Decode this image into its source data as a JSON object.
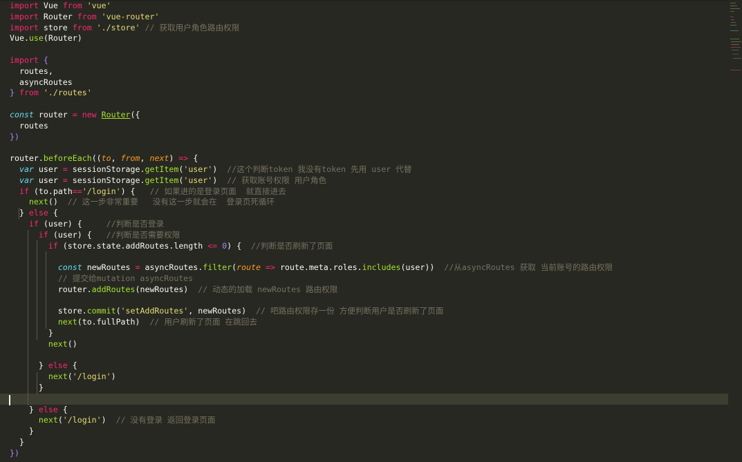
{
  "editor": {
    "lines": [
      [
        [
          "k",
          "import"
        ],
        [
          "t",
          " Vue "
        ],
        [
          "k",
          "from"
        ],
        [
          "t",
          " "
        ],
        [
          "s",
          "'vue'"
        ]
      ],
      [
        [
          "k",
          "import"
        ],
        [
          "t",
          " Router "
        ],
        [
          "k",
          "from"
        ],
        [
          "t",
          " "
        ],
        [
          "s",
          "'vue-router'"
        ]
      ],
      [
        [
          "k",
          "import"
        ],
        [
          "t",
          " store "
        ],
        [
          "k",
          "from"
        ],
        [
          "t",
          " "
        ],
        [
          "s",
          "'./store'"
        ],
        [
          "t",
          " "
        ],
        [
          "c",
          "// 获取用户角色路由权限"
        ]
      ],
      [
        [
          "t",
          "Vue."
        ],
        [
          "f",
          "use"
        ],
        [
          "t",
          "(Router)"
        ]
      ],
      [],
      [
        [
          "k",
          "import"
        ],
        [
          "t",
          " "
        ],
        [
          "n",
          "{"
        ]
      ],
      [
        [
          "t",
          "  routes,"
        ]
      ],
      [
        [
          "t",
          "  asyncRoutes"
        ]
      ],
      [
        [
          "n",
          "}"
        ],
        [
          "t",
          " "
        ],
        [
          "k",
          "from"
        ],
        [
          "t",
          " "
        ],
        [
          "s",
          "'./routes'"
        ]
      ],
      [],
      [
        [
          "b",
          "const"
        ],
        [
          "t",
          " router "
        ],
        [
          "k",
          "="
        ],
        [
          "t",
          " "
        ],
        [
          "k",
          "new"
        ],
        [
          "t",
          " "
        ],
        [
          "cls",
          "Router"
        ],
        [
          "t",
          "({"
        ]
      ],
      [
        [
          "t",
          "  routes"
        ]
      ],
      [
        [
          "n",
          "})"
        ]
      ],
      [],
      [
        [
          "t",
          "router."
        ],
        [
          "f",
          "beforeEach"
        ],
        [
          "t",
          "(("
        ],
        [
          "p",
          "to"
        ],
        [
          "t",
          ", "
        ],
        [
          "p",
          "from"
        ],
        [
          "t",
          ", "
        ],
        [
          "p",
          "next"
        ],
        [
          "t",
          ") "
        ],
        [
          "k",
          "=>"
        ],
        [
          "t",
          " {"
        ]
      ],
      [
        [
          "t",
          "  "
        ],
        [
          "b",
          "var"
        ],
        [
          "t",
          " user "
        ],
        [
          "k",
          "="
        ],
        [
          "t",
          " sessionStorage."
        ],
        [
          "f",
          "getItem"
        ],
        [
          "t",
          "("
        ],
        [
          "s",
          "'user'"
        ],
        [
          "t",
          ")  "
        ],
        [
          "c",
          "//这个判断token 我没有token 先用 user 代替"
        ]
      ],
      [
        [
          "t",
          "  "
        ],
        [
          "b",
          "var"
        ],
        [
          "t",
          " user "
        ],
        [
          "k",
          "="
        ],
        [
          "t",
          " sessionStorage."
        ],
        [
          "f",
          "getItem"
        ],
        [
          "t",
          "("
        ],
        [
          "s",
          "'user'"
        ],
        [
          "t",
          ")  "
        ],
        [
          "c",
          "// 获取账号权限 用户角色"
        ]
      ],
      [
        [
          "t",
          "  "
        ],
        [
          "k",
          "if"
        ],
        [
          "t",
          " (to.path"
        ],
        [
          "k",
          "=="
        ],
        [
          "s",
          "'/login'"
        ],
        [
          "t",
          ") {   "
        ],
        [
          "c",
          "// 如果进的是登录页面  就直接进去"
        ]
      ],
      [
        [
          "t",
          "    "
        ],
        [
          "f",
          "next"
        ],
        [
          "t",
          "()  "
        ],
        [
          "c",
          "// 这一步非常重要   没有这一步就会在  登录页死循环"
        ]
      ],
      [
        [
          "t",
          "  } "
        ],
        [
          "k",
          "else"
        ],
        [
          "t",
          " {"
        ]
      ],
      [
        [
          "t",
          "    "
        ],
        [
          "k",
          "if"
        ],
        [
          "t",
          " (user) {     "
        ],
        [
          "c",
          "//判断是否登录"
        ]
      ],
      [
        [
          "t",
          "      "
        ],
        [
          "k",
          "if"
        ],
        [
          "t",
          " (user) {   "
        ],
        [
          "c",
          "//判断是否需要权限"
        ]
      ],
      [
        [
          "t",
          "        "
        ],
        [
          "k",
          "if"
        ],
        [
          "t",
          " (store.state.addRoutes.length "
        ],
        [
          "k",
          "<="
        ],
        [
          "t",
          " "
        ],
        [
          "n",
          "0"
        ],
        [
          "t",
          ") {  "
        ],
        [
          "c",
          "//判断是否刷新了页面"
        ]
      ],
      [],
      [
        [
          "t",
          "          "
        ],
        [
          "b",
          "const"
        ],
        [
          "t",
          " newRoutes "
        ],
        [
          "k",
          "="
        ],
        [
          "t",
          " asyncRoutes."
        ],
        [
          "f",
          "filter"
        ],
        [
          "t",
          "("
        ],
        [
          "p",
          "route"
        ],
        [
          "t",
          " "
        ],
        [
          "k",
          "=>"
        ],
        [
          "t",
          " route.meta.roles."
        ],
        [
          "f",
          "includes"
        ],
        [
          "t",
          "(user))  "
        ],
        [
          "c",
          "//从asyncRoutes 获取 当前账号的路由权限"
        ]
      ],
      [
        [
          "t",
          "          "
        ],
        [
          "c",
          "// 提交给mutation asyncRoutes"
        ]
      ],
      [
        [
          "t",
          "          router."
        ],
        [
          "f",
          "addRoutes"
        ],
        [
          "t",
          "(newRoutes)  "
        ],
        [
          "c",
          "// 动态的加载 newRoutes 路由权限"
        ]
      ],
      [],
      [
        [
          "t",
          "          store."
        ],
        [
          "f",
          "commit"
        ],
        [
          "t",
          "("
        ],
        [
          "s",
          "'setAddRoutes'"
        ],
        [
          "t",
          ", newRoutes)  "
        ],
        [
          "c",
          "// 吧路由权限存一份 方便判断用户是否刷新了页面"
        ]
      ],
      [
        [
          "t",
          "          "
        ],
        [
          "f",
          "next"
        ],
        [
          "t",
          "(to.fullPath)  "
        ],
        [
          "c",
          "// 用户刷新了页面 在跳回去"
        ]
      ],
      [
        [
          "t",
          "        }"
        ]
      ],
      [
        [
          "t",
          "        "
        ],
        [
          "f",
          "next"
        ],
        [
          "t",
          "()"
        ]
      ],
      [],
      [
        [
          "t",
          "      } "
        ],
        [
          "k",
          "else"
        ],
        [
          "t",
          " {"
        ]
      ],
      [
        [
          "t",
          "        "
        ],
        [
          "f",
          "next"
        ],
        [
          "t",
          "("
        ],
        [
          "s",
          "'/login'"
        ],
        [
          "t",
          ")"
        ]
      ],
      [
        [
          "t",
          "      }"
        ]
      ],
      [],
      [
        [
          "t",
          "    } "
        ],
        [
          "k",
          "else"
        ],
        [
          "t",
          " {"
        ]
      ],
      [
        [
          "t",
          "      "
        ],
        [
          "f",
          "next"
        ],
        [
          "t",
          "("
        ],
        [
          "s",
          "'/login'"
        ],
        [
          "t",
          ")  "
        ],
        [
          "c",
          "// 没有登录 返回登录页面"
        ]
      ],
      [
        [
          "t",
          "    }"
        ]
      ],
      [
        [
          "t",
          "  }"
        ]
      ],
      [
        [
          "n",
          "})"
        ]
      ]
    ],
    "current_line_index": 36,
    "colors": {
      "background": "#272822",
      "keyword": "#f92672",
      "string": "#e6db74",
      "comment": "#75715e",
      "function": "#a6e22e",
      "storage": "#66d9ef",
      "parameter": "#fd971f",
      "number": "#ae81ff",
      "text": "#f8f8f2"
    }
  }
}
